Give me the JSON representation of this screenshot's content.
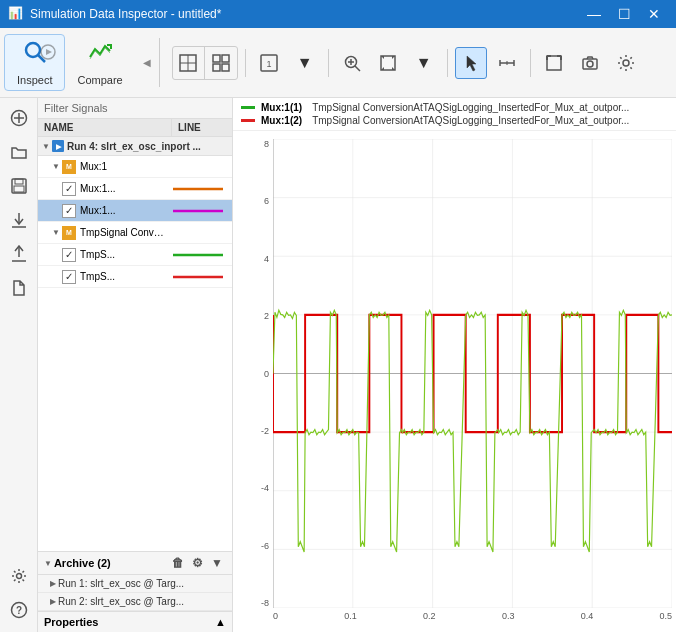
{
  "window": {
    "title": "Simulation Data Inspector - untitled*",
    "icon": "📊"
  },
  "toolbar": {
    "inspect_label": "Inspect",
    "compare_label": "Compare",
    "filter_signals_label": "Filter Signals"
  },
  "signal_panel": {
    "col_name": "NAME",
    "col_line": "LINE",
    "run_label": "Run 4: slrt_ex_osc_inport ...",
    "mux1_label": "Mux:1",
    "mux1_sub1_name": "Mux:1...",
    "mux1_sub2_name": "Mux:1...",
    "tmpsignal_group": "TmpSignal Conversi...",
    "tmps1_name": "TmpS...",
    "tmps2_name": "TmpS..."
  },
  "archive": {
    "label": "Archive (2)",
    "run1": "Run 1: slrt_ex_osc @ Targ...",
    "run2": "Run 2: slrt_ex_osc @ Targ..."
  },
  "properties": {
    "label": "Properties"
  },
  "legend": {
    "item1_label": "Mux:1(1)",
    "item1_detail": "TmpSignal ConversionAtTAQSigLogging_InsertedFor_Mux_at_outpor...",
    "item1_color": "#22aa22",
    "item2_label": "Mux:1(2)",
    "item2_detail": "TmpSignal ConversionAtTAQSigLogging_InsertedFor_Mux_at_outpor...",
    "item2_color": "#dd2222"
  },
  "plot": {
    "y_labels": [
      "8",
      "6",
      "4",
      "2",
      "0",
      "-2",
      "-4",
      "-6",
      "-8"
    ],
    "x_labels": [
      "0",
      "0.1",
      "0.2",
      "0.3",
      "0.4",
      "0.5"
    ],
    "signal_colors": {
      "green": "#7ec820",
      "red": "#dd0000",
      "magenta": "#dd00dd"
    }
  },
  "sidebar_icons": {
    "add": "+",
    "folder": "📁",
    "save": "💾",
    "download": "⬇",
    "upload": "⬆",
    "file": "📄",
    "settings": "⚙",
    "help": "?"
  }
}
